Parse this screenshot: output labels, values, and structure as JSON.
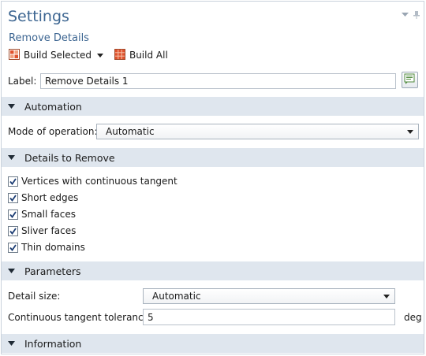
{
  "window": {
    "title": "Settings",
    "subtitle": "Remove Details"
  },
  "toolbar": {
    "build_selected": "Build Selected",
    "build_all": "Build All"
  },
  "label_field": {
    "label": "Label:",
    "value": "Remove Details 1"
  },
  "sections": {
    "automation": {
      "title": "Automation",
      "mode_label": "Mode of operation:",
      "mode_value": "Automatic"
    },
    "details": {
      "title": "Details to Remove",
      "items": [
        {
          "label": "Vertices with continuous tangent",
          "checked": true
        },
        {
          "label": "Short edges",
          "checked": true
        },
        {
          "label": "Small faces",
          "checked": true
        },
        {
          "label": "Sliver faces",
          "checked": true
        },
        {
          "label": "Thin domains",
          "checked": true
        }
      ]
    },
    "parameters": {
      "title": "Parameters",
      "detail_size_label": "Detail size:",
      "detail_size_value": "Automatic",
      "tangent_label": "Continuous tangent tolerance:",
      "tangent_value": "5",
      "tangent_unit": "deg"
    },
    "information": {
      "title": "Information"
    }
  },
  "colors": {
    "title": "#3c6591",
    "section_bg": "#dfe6ee",
    "build_icon": "#e0522d"
  }
}
